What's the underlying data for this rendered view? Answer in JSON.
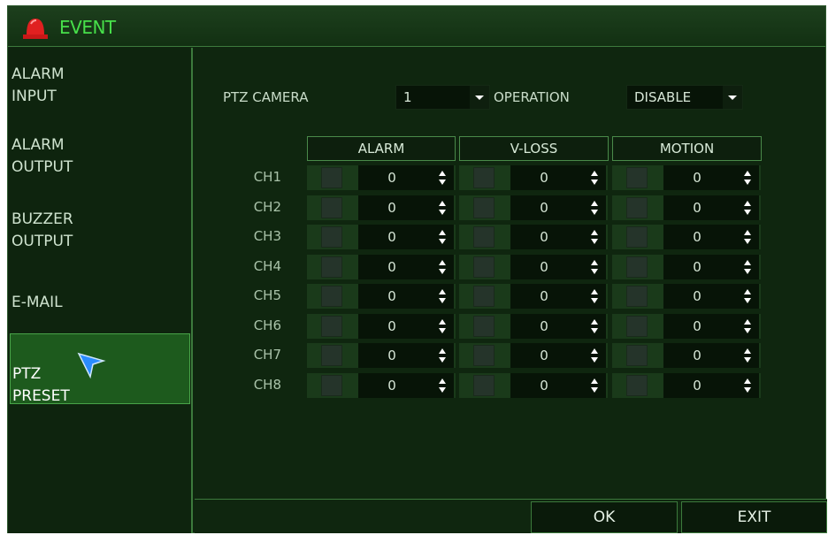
{
  "header": {
    "title": "EVENT",
    "icon": "alarm-siren-icon"
  },
  "sidebar": {
    "items": [
      {
        "label": "ALARM\nINPUT"
      },
      {
        "label": "ALARM\nOUTPUT"
      },
      {
        "label": "BUZZER\nOUTPUT"
      },
      {
        "label": "E-MAIL"
      },
      {
        "label": "PTZ\nPRESET",
        "selected": true
      }
    ]
  },
  "form": {
    "ptz_camera_label": "PTZ CAMERA",
    "ptz_camera_value": "1",
    "operation_label": "OPERATION",
    "operation_value": "DISABLE"
  },
  "table": {
    "columns": [
      "ALARM",
      "V-LOSS",
      "MOTION"
    ],
    "rows": [
      {
        "ch": "CH1",
        "alarm": "0",
        "vloss": "0",
        "motion": "0"
      },
      {
        "ch": "CH2",
        "alarm": "0",
        "vloss": "0",
        "motion": "0"
      },
      {
        "ch": "CH3",
        "alarm": "0",
        "vloss": "0",
        "motion": "0"
      },
      {
        "ch": "CH4",
        "alarm": "0",
        "vloss": "0",
        "motion": "0"
      },
      {
        "ch": "CH5",
        "alarm": "0",
        "vloss": "0",
        "motion": "0"
      },
      {
        "ch": "CH6",
        "alarm": "0",
        "vloss": "0",
        "motion": "0"
      },
      {
        "ch": "CH7",
        "alarm": "0",
        "vloss": "0",
        "motion": "0"
      },
      {
        "ch": "CH8",
        "alarm": "0",
        "vloss": "0",
        "motion": "0"
      }
    ]
  },
  "buttons": {
    "ok": "OK",
    "exit": "EXIT"
  },
  "colors": {
    "background": "#0f260f",
    "accent": "#3c7a3c",
    "title": "#47e04a",
    "selected": "#1d5a1d"
  }
}
